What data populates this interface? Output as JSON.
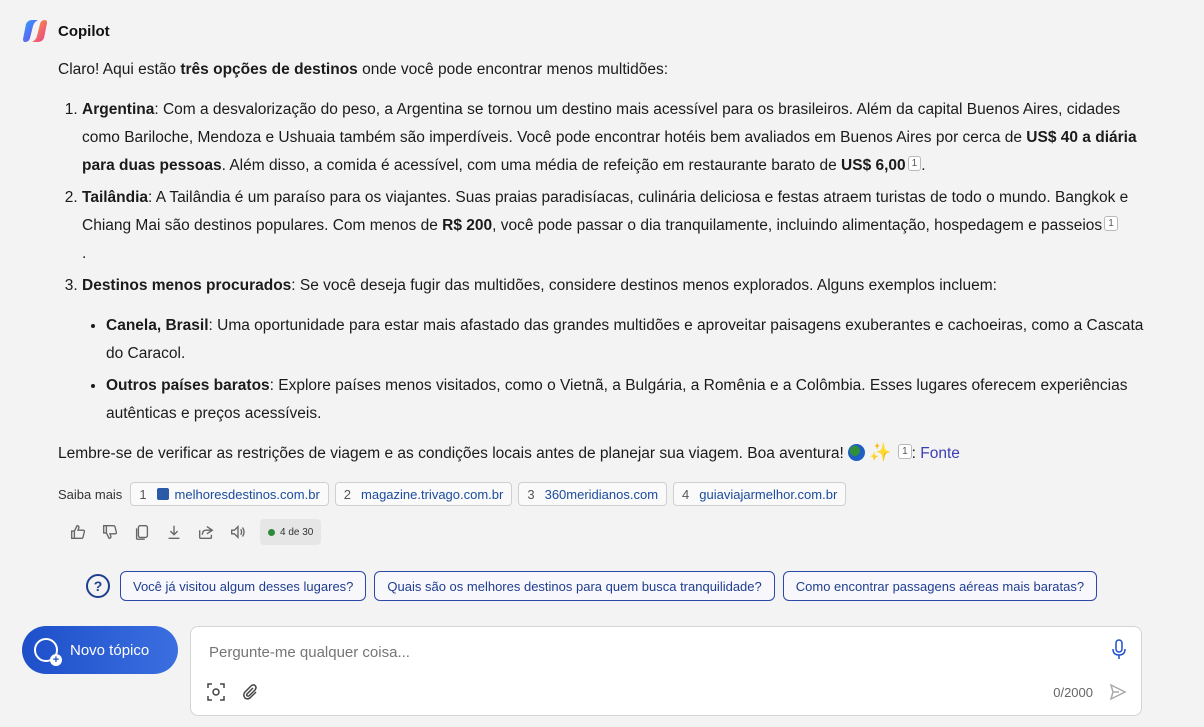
{
  "app": {
    "name": "Copilot"
  },
  "message": {
    "intro_pre": "Claro! Aqui estão ",
    "intro_bold": "três opções de destinos",
    "intro_post": " onde você pode encontrar menos multidões:",
    "items": [
      {
        "title": "Argentina",
        "t1": ": Com a desvalorização do peso, a Argentina se tornou um destino mais acessível para os brasileiros. Além da capital Buenos Aires, cidades como Bariloche, Mendoza e Ushuaia também são imperdíveis. Você pode encontrar hotéis bem avaliados em Buenos Aires por cerca de ",
        "b1": "US$ 40 a diária para duas pessoas",
        "t2": ". Além disso, a comida é acessível, com uma média de refeição em restaurante barato de ",
        "b2": "US$ 6,00",
        "cite": "1",
        "t3": "."
      },
      {
        "title": "Tailândia",
        "t1": ": A Tailândia é um paraíso para os viajantes. Suas praias paradisíacas, culinária deliciosa e festas atraem turistas de todo o mundo. Bangkok e Chiang Mai são destinos populares. Com menos de ",
        "b1": "R$ 200",
        "t2": ", você pode passar o dia tranquilamente, incluindo alimentação, hospedagem e passeios",
        "cite": "1",
        "t3": "."
      },
      {
        "title": "Destinos menos procurados",
        "t1": ": Se você deseja fugir das multidões, considere destinos menos explorados. Alguns exemplos incluem:",
        "sub": [
          {
            "title": "Canela, Brasil",
            "text": ": Uma oportunidade para estar mais afastado das grandes multidões e aproveitar paisagens exuberantes e cachoeiras, como a Cascata do Caracol."
          },
          {
            "title": "Outros países baratos",
            "text": ": Explore países menos visitados, como o Vietnã, a Bulgária, a Romênia e a Colômbia. Esses lugares oferecem experiências autênticas e preços acessíveis."
          }
        ]
      }
    ],
    "closing": "Lembre-se de verificar as restrições de viagem e as condições locais antes de planejar sua viagem. Boa aventura! ",
    "closing_emoji_2": "✨",
    "closing_cite": "1",
    "closing_sep": ": ",
    "closing_link": "Fonte"
  },
  "sources": {
    "label": "Saiba mais",
    "items": [
      {
        "num": "1",
        "site": "melhoresdestinos.com.br"
      },
      {
        "num": "2",
        "site": "magazine.trivago.com.br"
      },
      {
        "num": "3",
        "site": "360meridianos.com"
      },
      {
        "num": "4",
        "site": "guiaviajarmelhor.com.br"
      }
    ]
  },
  "actions": {
    "counter": "4 de 30"
  },
  "suggestions": {
    "icon": "?",
    "items": [
      "Você já visitou algum desses lugares?",
      "Quais são os melhores destinos para quem busca tranquilidade?",
      "Como encontrar passagens aéreas mais baratas?"
    ]
  },
  "new_topic": {
    "label": "Novo tópico"
  },
  "composer": {
    "placeholder": "Pergunte-me qualquer coisa...",
    "char_count": "0/2000"
  },
  "colors": {
    "accent": "#1d4fc9",
    "link": "#1a4b9c",
    "status_dot": "#2e8b3c"
  }
}
